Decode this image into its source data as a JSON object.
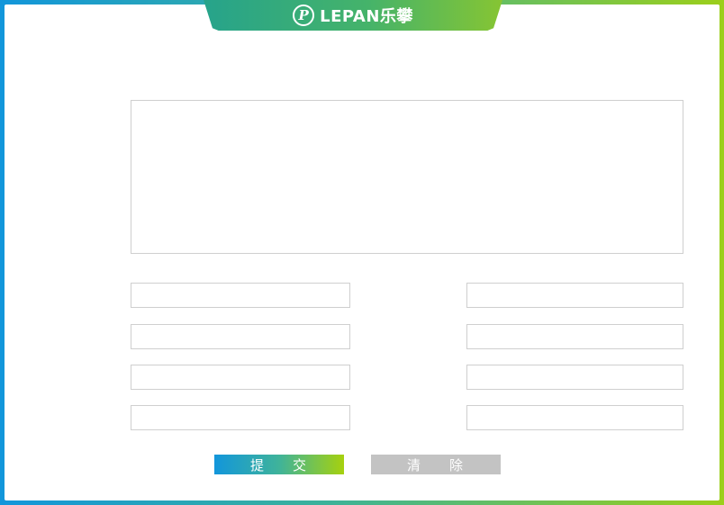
{
  "header": {
    "logo_mark": "℗",
    "logo_text": "LEPAN乐攀"
  },
  "form": {
    "message": {
      "value": "",
      "placeholder": ""
    },
    "fields": [
      {
        "value": "",
        "placeholder": ""
      },
      {
        "value": "",
        "placeholder": ""
      },
      {
        "value": "",
        "placeholder": ""
      },
      {
        "value": "",
        "placeholder": ""
      },
      {
        "value": "",
        "placeholder": ""
      },
      {
        "value": "",
        "placeholder": ""
      },
      {
        "value": "",
        "placeholder": ""
      },
      {
        "value": "",
        "placeholder": ""
      }
    ],
    "submit_chars": [
      "提",
      "交"
    ],
    "clear_chars": [
      "清",
      "除"
    ]
  },
  "colors": {
    "frame_start": "#1296db",
    "frame_end": "#9ccf1a",
    "header_tab": "#3bb07a",
    "clear_button": "#c3c3c3"
  }
}
